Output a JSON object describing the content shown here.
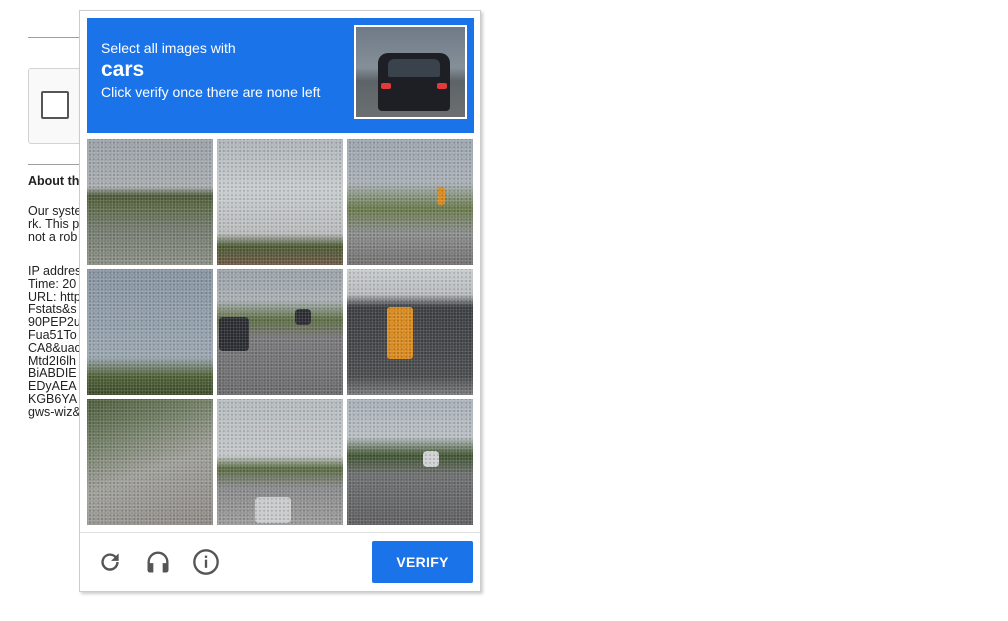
{
  "background": {
    "about_heading": "About th",
    "text_lines_1": [
      "Our syste",
      "rk. This p",
      "not a rob"
    ],
    "text_lines_2": [
      "IP addres",
      "Time: 20",
      "URL: http",
      "Fstats&s",
      "90PEP2u",
      "Fua51To",
      "CA8&uac",
      "Mtd2I6lh",
      "BiABDIE",
      "EDyAEA",
      "KGB6YA",
      "gws-wiz&"
    ]
  },
  "challenge": {
    "instruction_line1": "Select all images with",
    "target": "cars",
    "instruction_line3": "Click verify once there are none left",
    "sample_image": "car-rear-view",
    "tiles": [
      "roadside-trees-powerline",
      "cloudy-sky-fence",
      "traffic-light-intersection",
      "sky-treeline",
      "street-with-cars",
      "traffic-light-closeup",
      "guardrail-grass",
      "intersection-car",
      "road-with-car"
    ],
    "verify_label": "VERIFY",
    "footer_icons": [
      "reload-icon",
      "headphones-icon",
      "info-icon"
    ],
    "accent_color": "#1a73e8"
  }
}
